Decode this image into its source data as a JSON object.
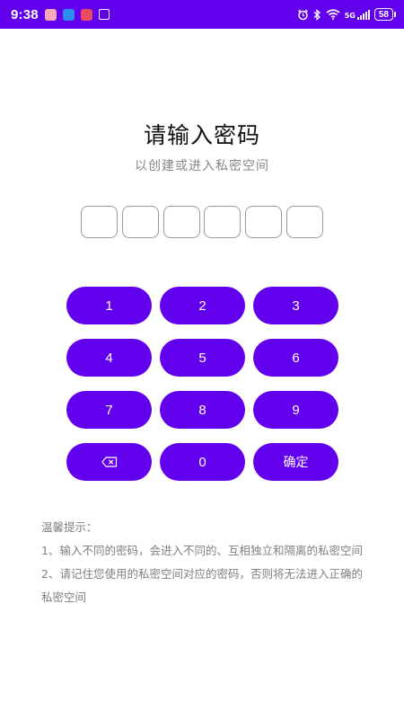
{
  "status_bar": {
    "time": "9:38",
    "network": "5G",
    "battery": "58"
  },
  "page": {
    "title": "请输入密码",
    "subtitle": "以创建或进入私密空间"
  },
  "pin": {
    "length": 6
  },
  "keypad": {
    "keys": [
      "1",
      "2",
      "3",
      "4",
      "5",
      "6",
      "7",
      "8",
      "9"
    ],
    "zero": "0",
    "confirm": "确定",
    "backspace_icon": "backspace-icon"
  },
  "tips": {
    "heading": "温馨提示：",
    "line1": "1、输入不同的密码，会进入不同的、互相独立和隔离的私密空间",
    "line2": "2、请记住您使用的私密空间对应的密码，否则将无法进入正确的私密空间"
  },
  "colors": {
    "accent": "#6200ee",
    "text_primary": "#111111",
    "text_secondary": "#888888"
  }
}
